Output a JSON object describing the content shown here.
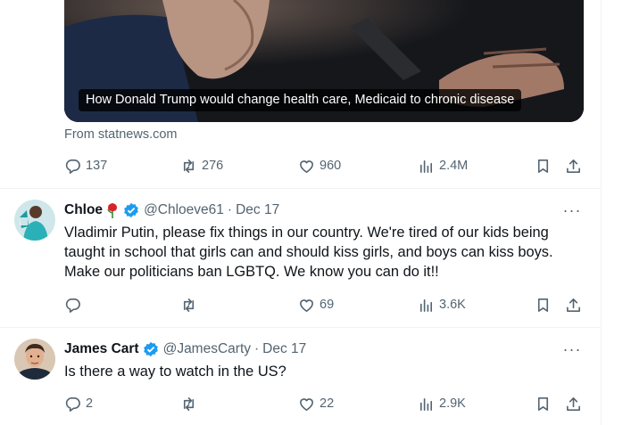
{
  "colors": {
    "text": "#0f1419",
    "secondary": "#536471",
    "verified": "#1d9bf0",
    "divider": "#eff3f4"
  },
  "card": {
    "caption": "How Donald Trump would change health care, Medicaid to chronic disease",
    "source": "From statnews.com"
  },
  "tweet1_actions": {
    "replies": "137",
    "retweets": "276",
    "likes": "960",
    "views": "2.4M"
  },
  "tweets": [
    {
      "name": "Chloe",
      "handle": "@Chloeve61",
      "separator": "·",
      "date": "Dec 17",
      "emoji": "rose-icon",
      "text": "Vladimir Putin, please fix things in our country. We're tired of our kids being taught in school that girls can and should kiss girls, and boys can kiss boys. Make our politicians ban LGBTQ. We know you can do it!!",
      "replies": "",
      "retweets": "",
      "likes": "69",
      "views": "3.6K"
    },
    {
      "name": "James Cart",
      "handle": "@JamesCarty",
      "separator": "·",
      "date": "Dec 17",
      "text": "Is there a way to watch in the US?",
      "replies": "2",
      "retweets": "",
      "likes": "22",
      "views": "2.9K"
    }
  ],
  "icons": [
    "reply-icon",
    "retweet-icon",
    "like-icon",
    "views-icon",
    "bookmark-icon",
    "share-icon",
    "verified-icon",
    "more-icon"
  ],
  "more_label": "···"
}
